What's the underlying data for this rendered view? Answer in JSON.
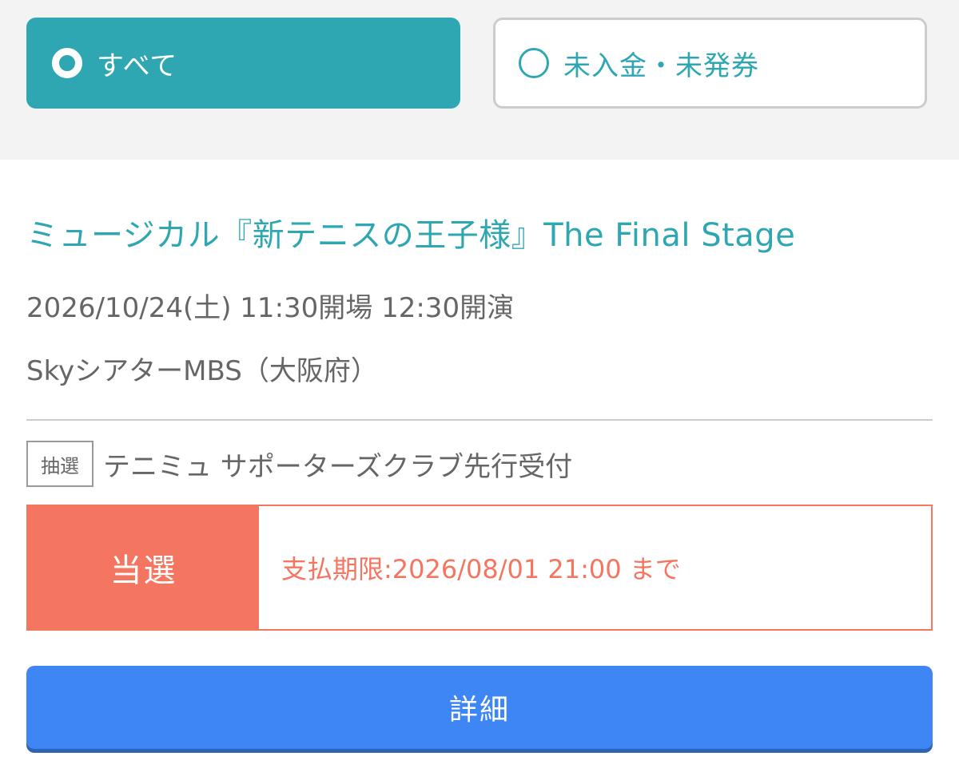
{
  "filters": {
    "all_label": "すべて",
    "unpaid_label": "未入金・未発券"
  },
  "event": {
    "title": "ミュージカル『新テニスの王子様』The Final Stage",
    "datetime": "2026/10/24(土) 11:30開場 12:30開演",
    "venue": "SkyシアターMBS（大阪府）"
  },
  "sale": {
    "badge": "抽選",
    "name": "テニミュ サポーターズクラブ先行受付"
  },
  "result": {
    "status": "当選",
    "deadline": "支払期限:2026/08/01 21:00 まで"
  },
  "actions": {
    "detail_label": "詳細"
  },
  "colors": {
    "accent": "#2fa7b3",
    "won": "#f47560",
    "primary_button": "#3e86f4",
    "filter_background": "#f3f3f3"
  }
}
